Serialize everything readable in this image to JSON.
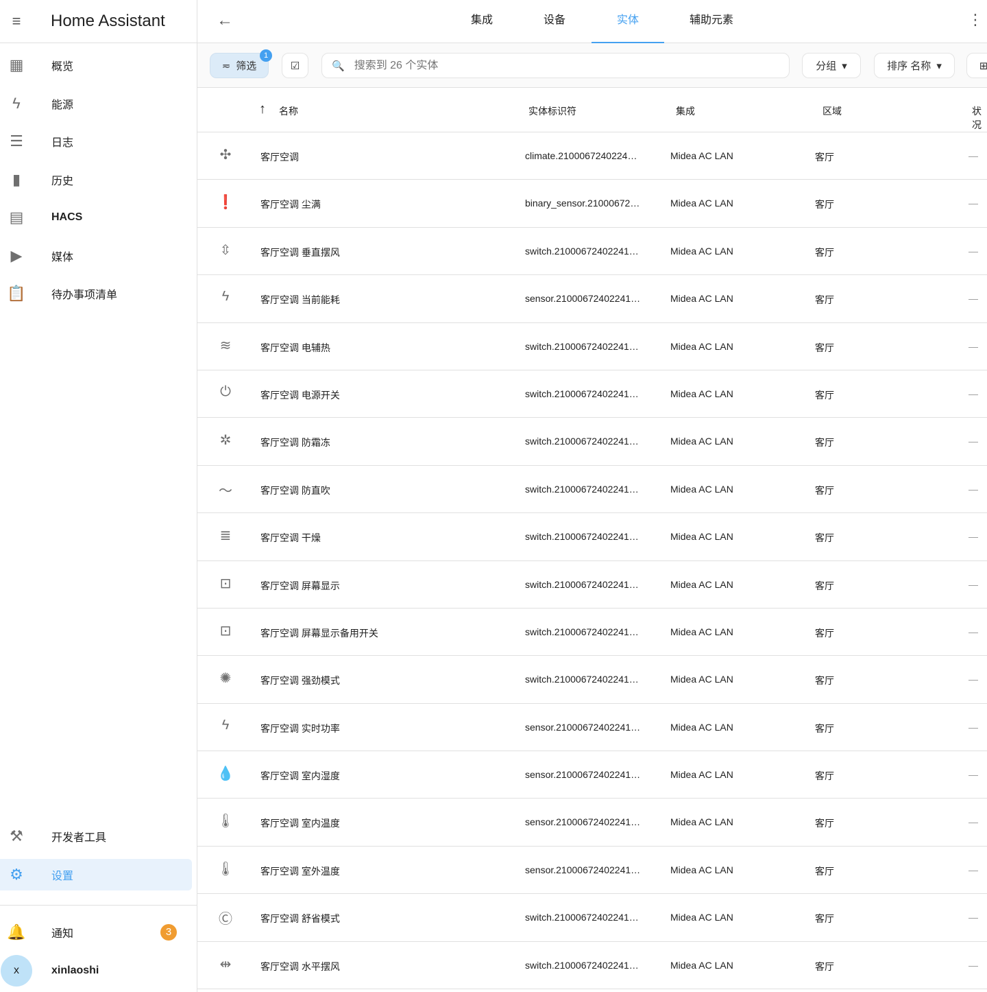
{
  "sidebar": {
    "title": "Home Assistant",
    "items": [
      {
        "label": "概览",
        "icon": "dashboard-icon",
        "glyph": "▦"
      },
      {
        "label": "能源",
        "icon": "lightning-icon",
        "glyph": "ϟ"
      },
      {
        "label": "日志",
        "icon": "list-icon",
        "glyph": "☰"
      },
      {
        "label": "历史",
        "icon": "chart-icon",
        "glyph": "▮"
      },
      {
        "label": "HACS",
        "icon": "hacs-icon",
        "glyph": "▤"
      },
      {
        "label": "媒体",
        "icon": "media-icon",
        "glyph": "▶"
      },
      {
        "label": "待办事项清单",
        "icon": "clipboard-icon",
        "glyph": "📋"
      }
    ],
    "developer_tools": "开发者工具",
    "settings": "设置",
    "notifications": "通知",
    "notification_count": "3",
    "user": "xinlaoshi",
    "user_initial": "x"
  },
  "tabs": [
    "集成",
    "设备",
    "实体",
    "辅助元素"
  ],
  "toolbar": {
    "filter": "筛选",
    "filter_count": "1",
    "search_placeholder": "搜索到 26 个实体",
    "group": "分组",
    "sort": "排序 名称"
  },
  "columns": {
    "name": "名称",
    "entity_id": "实体标识符",
    "integration": "集成",
    "area": "区域",
    "status": "状况"
  },
  "rows": [
    {
      "name": "客厅空调",
      "id": "climate.2100067240224…",
      "g": "✣"
    },
    {
      "name": "客厅空调 尘满",
      "id": "binary_sensor.21000672…",
      "g": "❗"
    },
    {
      "name": "客厅空调 垂直摆风",
      "id": "switch.21000672402241…",
      "g": "⇳"
    },
    {
      "name": "客厅空调 当前能耗",
      "id": "sensor.21000672402241…",
      "g": "ϟ"
    },
    {
      "name": "客厅空调 电辅热",
      "id": "switch.21000672402241…",
      "g": "≋"
    },
    {
      "name": "客厅空调 电源开关",
      "id": "switch.21000672402241…",
      "g": "⏻"
    },
    {
      "name": "客厅空调 防霜冻",
      "id": "switch.21000672402241…",
      "g": "✲"
    },
    {
      "name": "客厅空调 防直吹",
      "id": "switch.21000672402241…",
      "g": "〜"
    },
    {
      "name": "客厅空调 干燥",
      "id": "switch.21000672402241…",
      "g": "≣"
    },
    {
      "name": "客厅空调 屏幕显示",
      "id": "switch.21000672402241…",
      "g": "⊡"
    },
    {
      "name": "客厅空调 屏幕显示备用开关",
      "id": "switch.21000672402241…",
      "g": "⊡"
    },
    {
      "name": "客厅空调 强劲模式",
      "id": "switch.21000672402241…",
      "g": "✺"
    },
    {
      "name": "客厅空调 实时功率",
      "id": "sensor.21000672402241…",
      "g": "ϟ"
    },
    {
      "name": "客厅空调 室内湿度",
      "id": "sensor.21000672402241…",
      "g": "💧"
    },
    {
      "name": "客厅空调 室内温度",
      "id": "sensor.21000672402241…",
      "g": "🌡"
    },
    {
      "name": "客厅空调 室外温度",
      "id": "sensor.21000672402241…",
      "g": "🌡"
    },
    {
      "name": "客厅空调 舒省模式",
      "id": "switch.21000672402241…",
      "g": "Ⓒ"
    },
    {
      "name": "客厅空调 水平摆风",
      "id": "switch.21000672402241…",
      "g": "⇹"
    }
  ],
  "integration": "Midea AC LAN",
  "area": "客厅",
  "status_placeholder": "—"
}
